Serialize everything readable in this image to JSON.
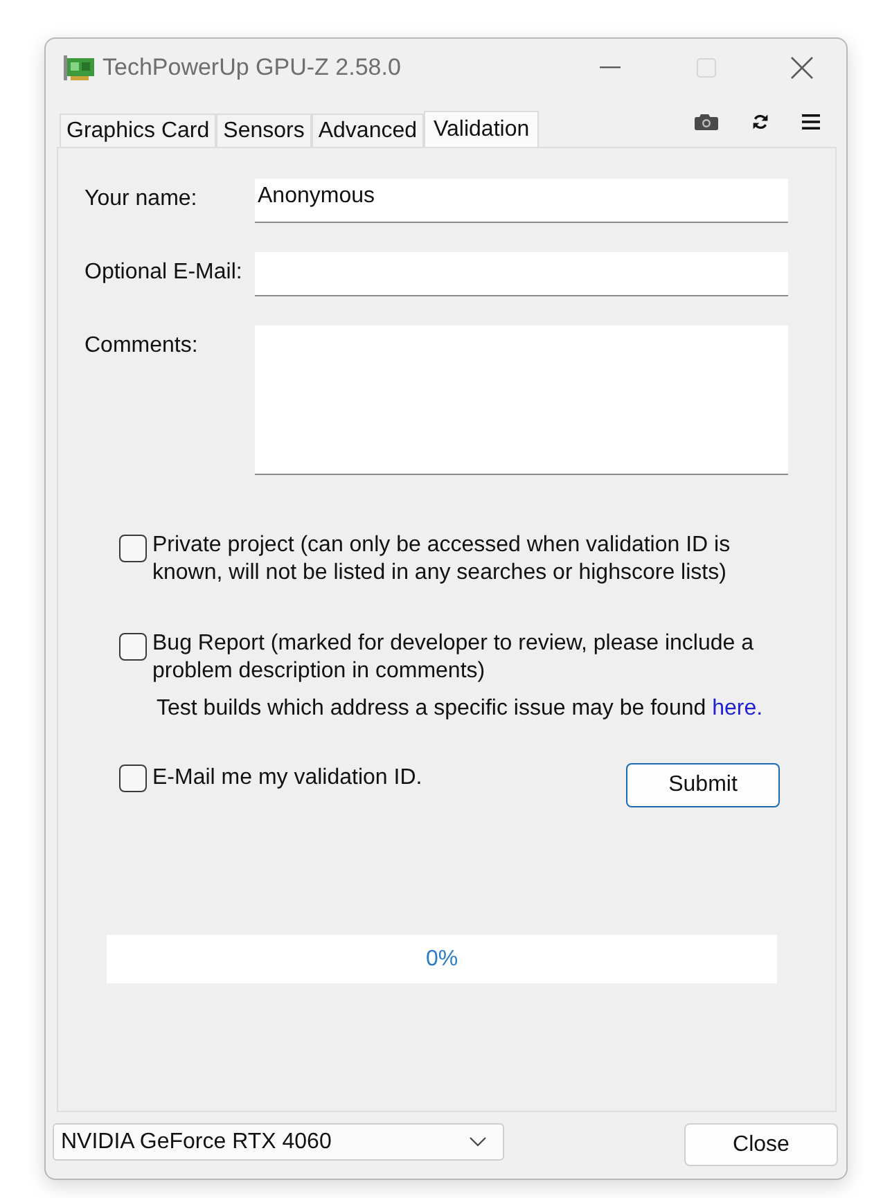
{
  "window": {
    "title": "TechPowerUp GPU-Z 2.58.0",
    "controls": [
      {
        "kind": "minimize",
        "disabled": false
      },
      {
        "kind": "maximize",
        "disabled": true
      },
      {
        "kind": "close",
        "disabled": false
      }
    ]
  },
  "tabs": [
    {
      "label": "Graphics Card",
      "selected": false
    },
    {
      "label": "Sensors",
      "selected": false
    },
    {
      "label": "Advanced",
      "selected": false
    },
    {
      "label": "Validation",
      "selected": true
    }
  ],
  "form": {
    "fields": [
      {
        "label": "Your name:",
        "kind": "input",
        "value": "Anonymous"
      },
      {
        "label": "Optional E-Mail:",
        "kind": "input"
      },
      {
        "label": "Comments:",
        "kind": "textarea"
      }
    ],
    "options": [
      {
        "label": "Private project (can only be accessed when validation ID is known, will not be listed in any searches or highscore lists)",
        "checked": false
      },
      {
        "label": "Bug Report (marked for developer to review, please include a problem description in comments)",
        "checked": false,
        "note": {
          "text": "Test builds which address a specific issue may be found ",
          "link": "here."
        }
      }
    ],
    "email_option": {
      "label": "E-Mail me my validation ID.",
      "checked": false
    },
    "submit": "Submit"
  },
  "progress": {
    "level": 0,
    "reading": "0%"
  },
  "footer": {
    "device": "NVIDIA GeForce RTX 4060",
    "close": "Close"
  }
}
